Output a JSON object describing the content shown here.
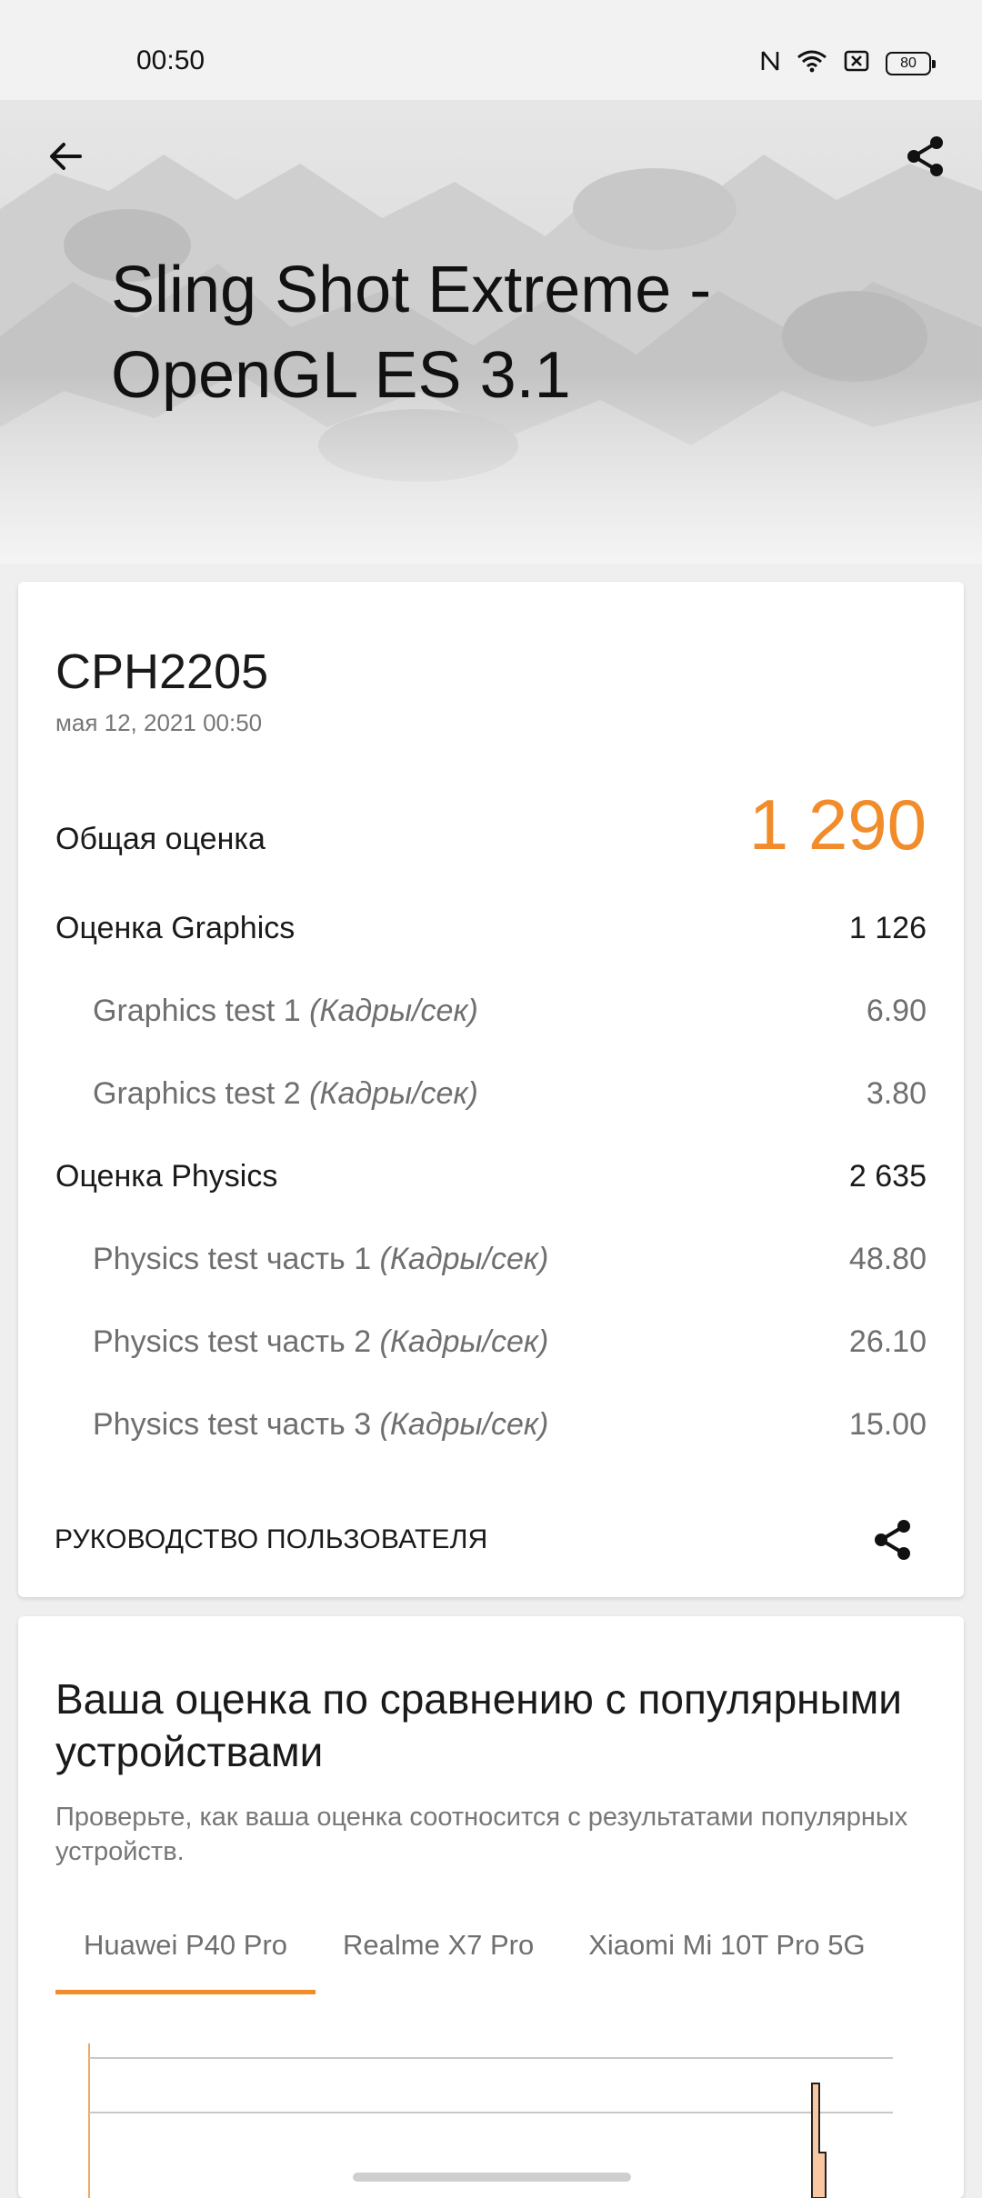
{
  "status_bar": {
    "time": "00:50",
    "battery": "80",
    "icons": [
      "nfc-icon",
      "wifi-icon",
      "sim-off-icon",
      "battery-icon"
    ]
  },
  "header": {
    "title": "Sling Shot Extreme - OpenGL ES 3.1",
    "back_icon": "arrow-left-icon",
    "share_icon": "share-icon"
  },
  "result": {
    "device": "CPH2205",
    "date": "мая 12, 2021 00:50",
    "total_label": "Общая оценка",
    "total_value": "1 290",
    "graphics_label": "Оценка Graphics",
    "graphics_value": "1 126",
    "gt1_label": "Graphics test 1 ",
    "gt1_unit": "(Кадры/сек)",
    "gt1_value": "6.90",
    "gt2_label": "Graphics test 2 ",
    "gt2_unit": "(Кадры/сек)",
    "gt2_value": "3.80",
    "physics_label": "Оценка Physics",
    "physics_value": "2 635",
    "pt1_label": "Physics test часть 1 ",
    "pt1_unit": "(Кадры/сек)",
    "pt1_value": "48.80",
    "pt2_label": "Physics test часть 2 ",
    "pt2_unit": "(Кадры/сек)",
    "pt2_value": "26.10",
    "pt3_label": "Physics test часть 3 ",
    "pt3_unit": "(Кадры/сек)",
    "pt3_value": "15.00",
    "guide_label": "РУКОВОДСТВО ПОЛЬЗОВАТЕЛЯ"
  },
  "comparison": {
    "title": "Ваша оценка по сравнению с популярными устройствами",
    "subtitle": "Проверьте, как ваша оценка соотносится с результатами популярных устройств.",
    "tabs": [
      "Huawei P40 Pro",
      "Realme X7 Pro",
      "Xiaomi Mi 10T Pro 5G"
    ],
    "active_tab": "Huawei P40 Pro"
  },
  "colors": {
    "accent": "#f28b2a",
    "text": "#1a1a1a",
    "muted": "#6f6f6f"
  }
}
